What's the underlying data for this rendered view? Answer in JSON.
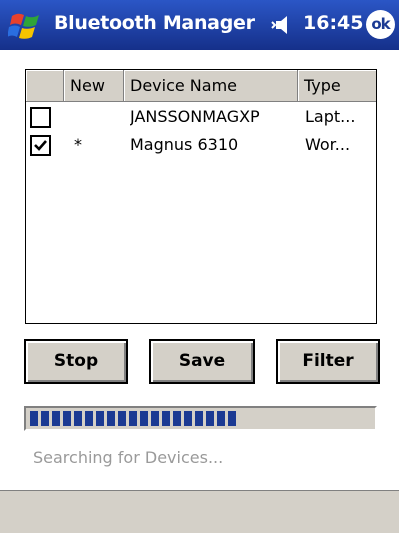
{
  "titlebar": {
    "title": "Bluetooth Manager",
    "time": "16:45",
    "ok_label": "ok",
    "start_icon": "windows-flag-icon",
    "volume_icon": "speaker-icon"
  },
  "list": {
    "columns": [
      "",
      "New",
      "Device Name",
      "Type"
    ],
    "rows": [
      {
        "checked": false,
        "new": "",
        "name": "JANSSONMAGXP",
        "type": "Lapt..."
      },
      {
        "checked": true,
        "new": "*",
        "name": "Magnus 6310",
        "type": "Wor..."
      }
    ]
  },
  "buttons": {
    "stop": "Stop",
    "save": "Save",
    "filter": "Filter"
  },
  "progress": {
    "fraction": 0.6,
    "color": "#1b3a93"
  },
  "status": "Searching for Devices...",
  "colors": {
    "titlebar": "#1b3a93",
    "chrome": "#d4d0c8"
  }
}
